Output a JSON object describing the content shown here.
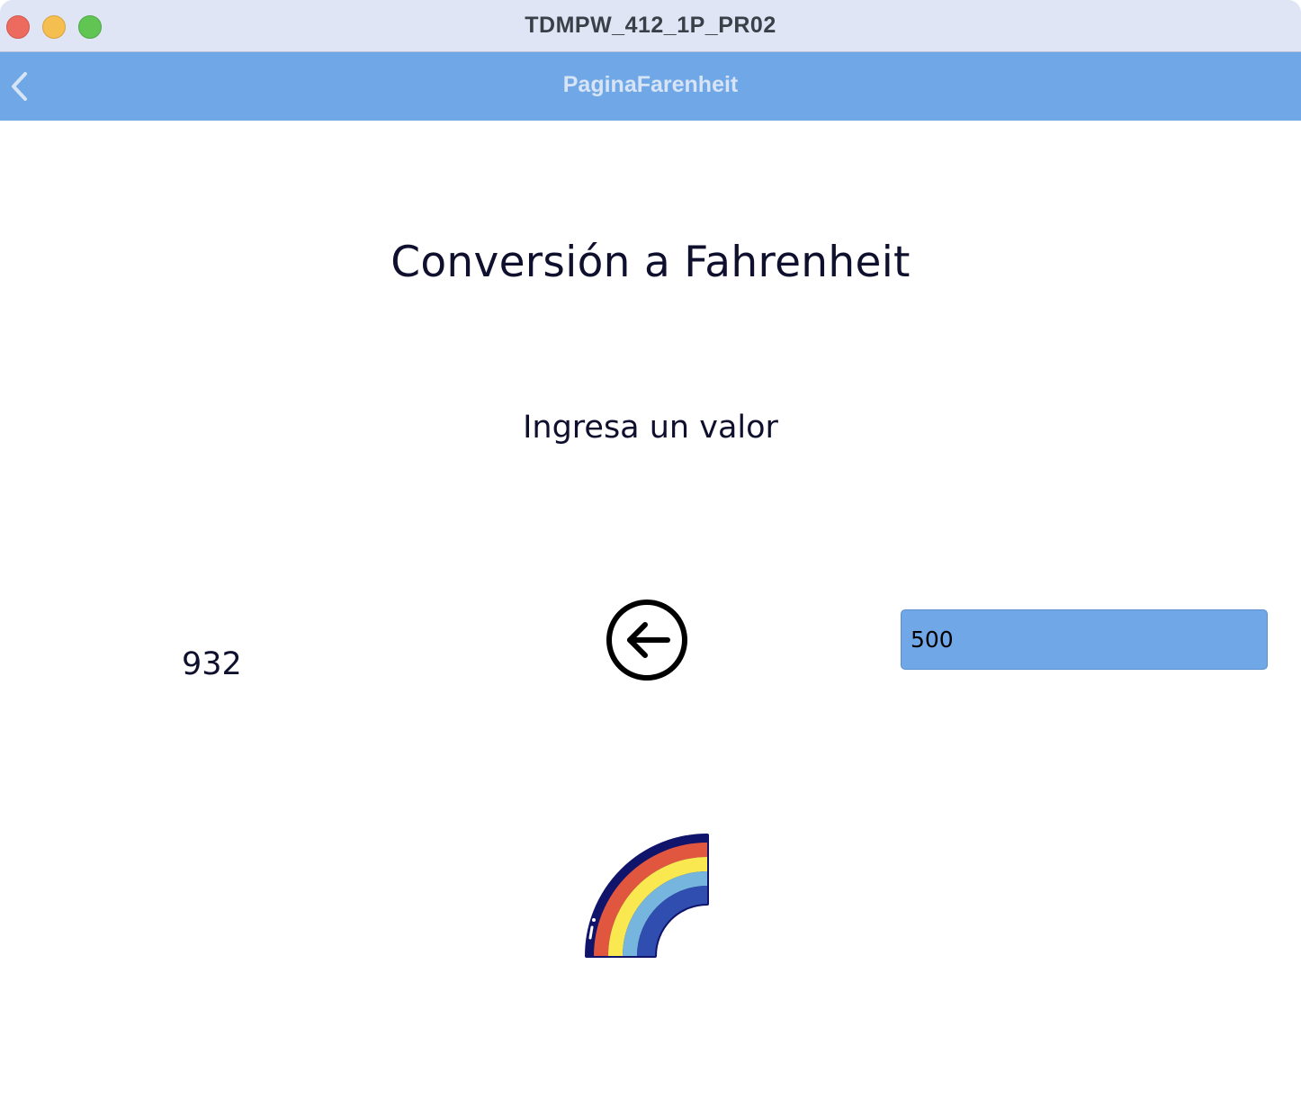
{
  "window": {
    "title": "TDMPW_412_1P_PR02"
  },
  "navbar": {
    "title": "PaginaFarenheit"
  },
  "main": {
    "heading": "Conversión a Fahrenheit",
    "prompt": "Ingresa un valor",
    "result": "932",
    "input_value": "500"
  },
  "icons": {
    "back": "chevron-left-icon",
    "convert": "arrow-left-circle-icon",
    "image": "rainbow-icon"
  },
  "colors": {
    "navbar": "#70a7e6",
    "input_background": "#70a7e6",
    "text": "#0f0f2e",
    "titlebar": "#dfe5f5"
  }
}
